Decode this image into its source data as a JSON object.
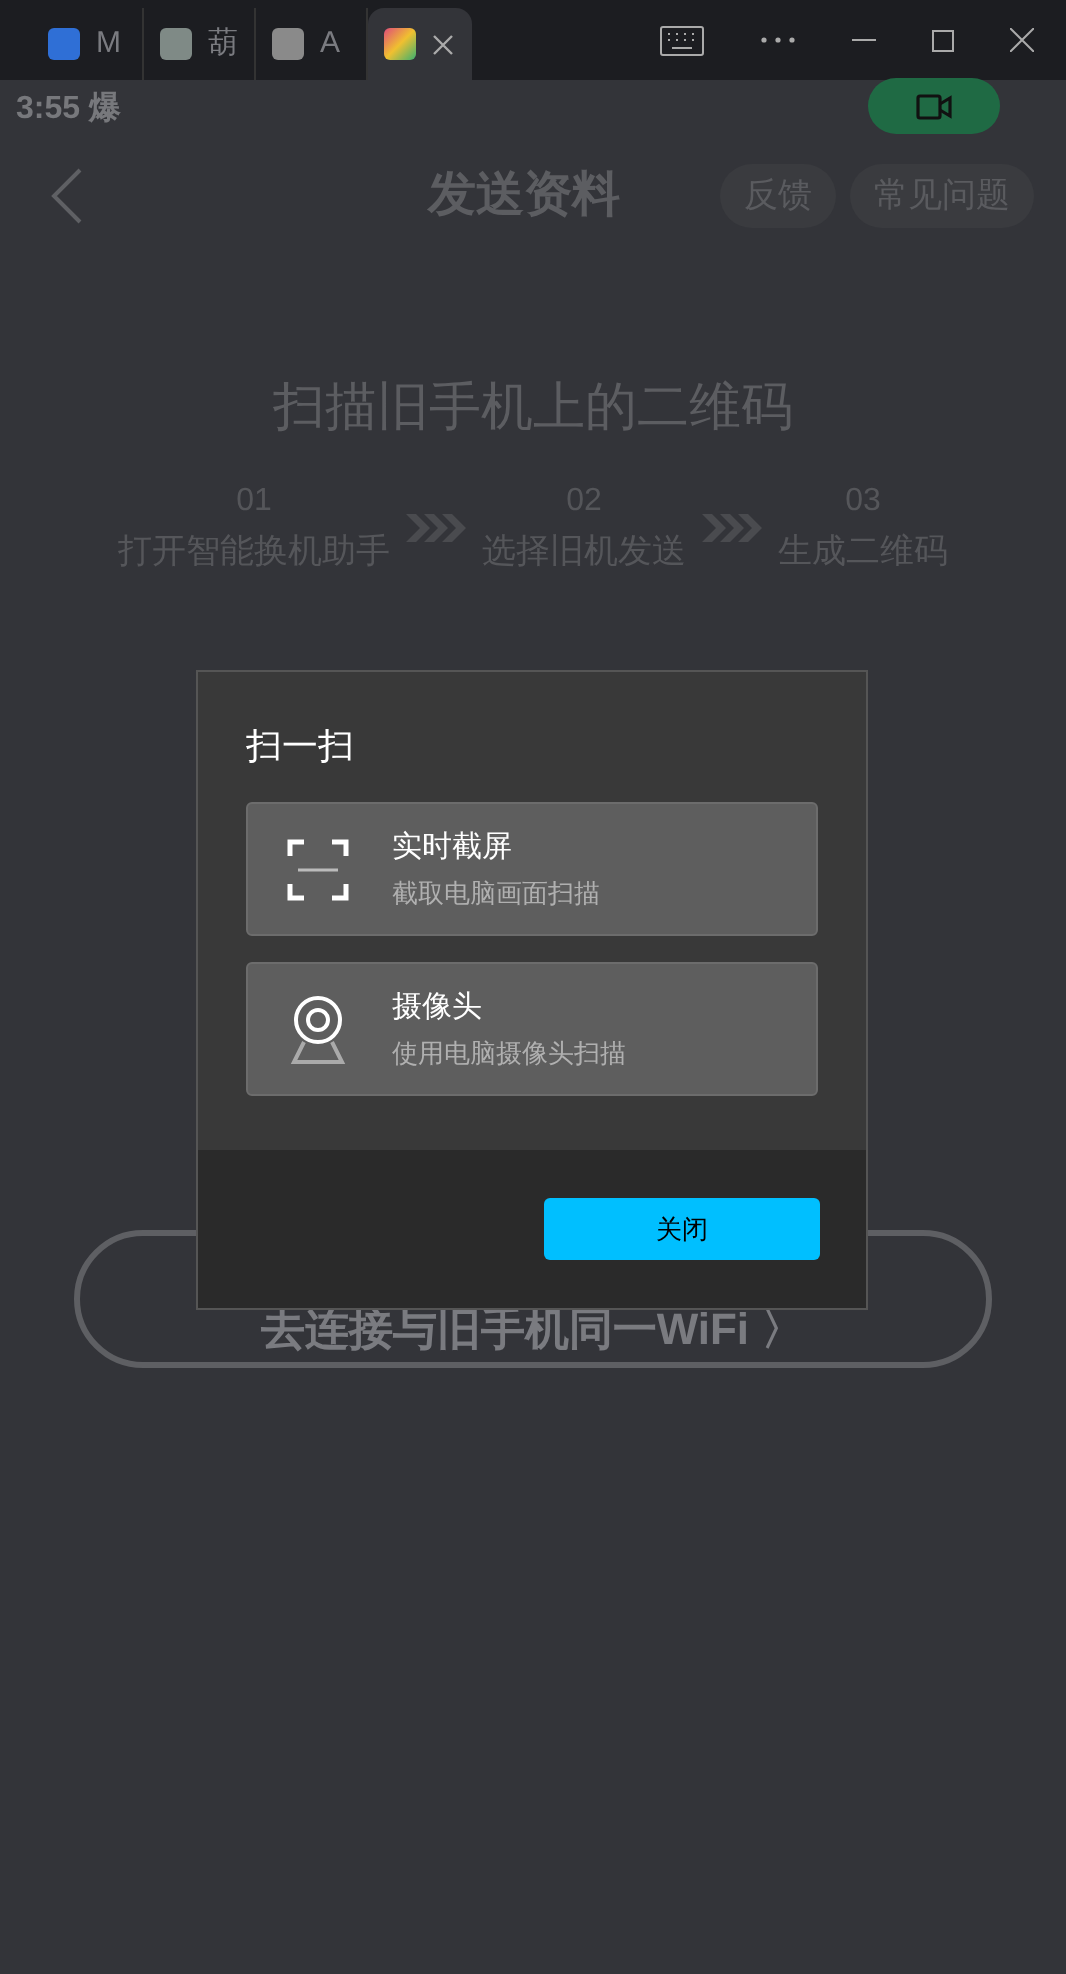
{
  "browser_tabs": [
    {
      "label": "M",
      "selected": false
    },
    {
      "label": "葫",
      "selected": false
    },
    {
      "label": "A",
      "selected": false
    },
    {
      "selected": true
    }
  ],
  "status_bar": {
    "time": "3:55 爆"
  },
  "header": {
    "title": "发送资料",
    "buttons": [
      "反馈",
      "常见问题"
    ]
  },
  "heading": "扫描旧手机上的二维码",
  "steps": [
    {
      "number": "01",
      "label": "打开智能换机助手"
    },
    {
      "number": "02",
      "label": "选择旧机发送"
    },
    {
      "number": "03",
      "label": "生成二维码"
    }
  ],
  "wifi_button": "去连接与旧手机同一WiFi 〉",
  "dialog": {
    "title": "扫一扫",
    "options": [
      {
        "kind": "screen",
        "title": "实时截屏",
        "subtitle": "截取电脑画面扫描"
      },
      {
        "kind": "camera",
        "title": "摄像头",
        "subtitle": "使用电脑摄像头扫描"
      }
    ],
    "close": "关闭"
  }
}
